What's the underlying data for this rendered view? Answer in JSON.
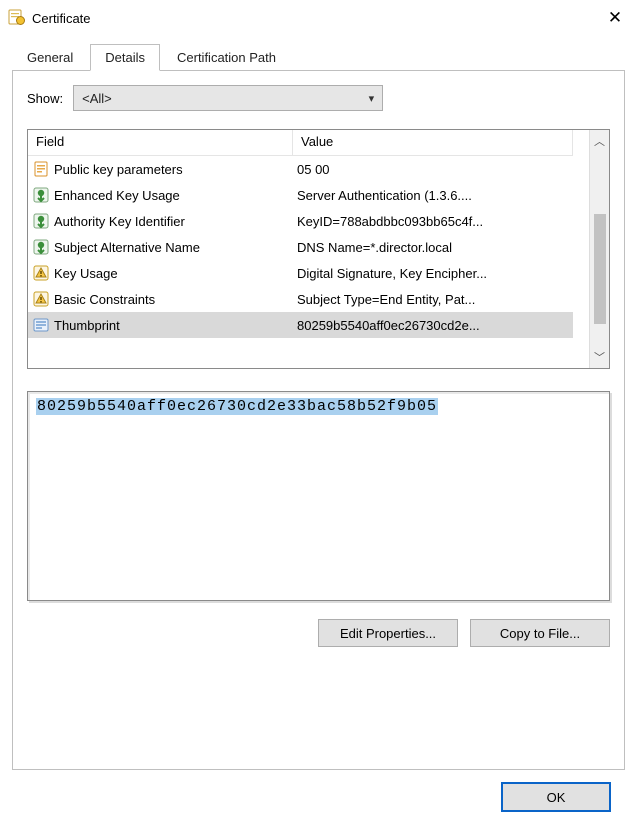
{
  "window": {
    "title": "Certificate",
    "close_glyph": "✕"
  },
  "tabs": {
    "general": "General",
    "details": "Details",
    "certpath": "Certification Path"
  },
  "filter": {
    "label": "Show:",
    "selected": "<All>"
  },
  "columns": {
    "field": "Field",
    "value": "Value"
  },
  "rows": [
    {
      "icon": "page",
      "field": "Public key parameters",
      "value": "05 00"
    },
    {
      "icon": "ext",
      "field": "Enhanced Key Usage",
      "value": "Server Authentication (1.3.6...."
    },
    {
      "icon": "ext",
      "field": "Authority Key Identifier",
      "value": "KeyID=788abdbbc093bb65c4f..."
    },
    {
      "icon": "ext",
      "field": "Subject Alternative Name",
      "value": "DNS Name=*.director.local"
    },
    {
      "icon": "warn",
      "field": "Key Usage",
      "value": "Digital Signature, Key Encipher..."
    },
    {
      "icon": "warn",
      "field": "Basic Constraints",
      "value": "Subject Type=End Entity, Pat..."
    },
    {
      "icon": "thumb",
      "field": "Thumbprint",
      "value": "80259b5540aff0ec26730cd2e..."
    }
  ],
  "selected_row_index": 6,
  "detail_value": "80259b5540aff0ec26730cd2e33bac58b52f9b05",
  "buttons": {
    "edit": "Edit Properties...",
    "copy": "Copy to File...",
    "ok": "OK"
  }
}
